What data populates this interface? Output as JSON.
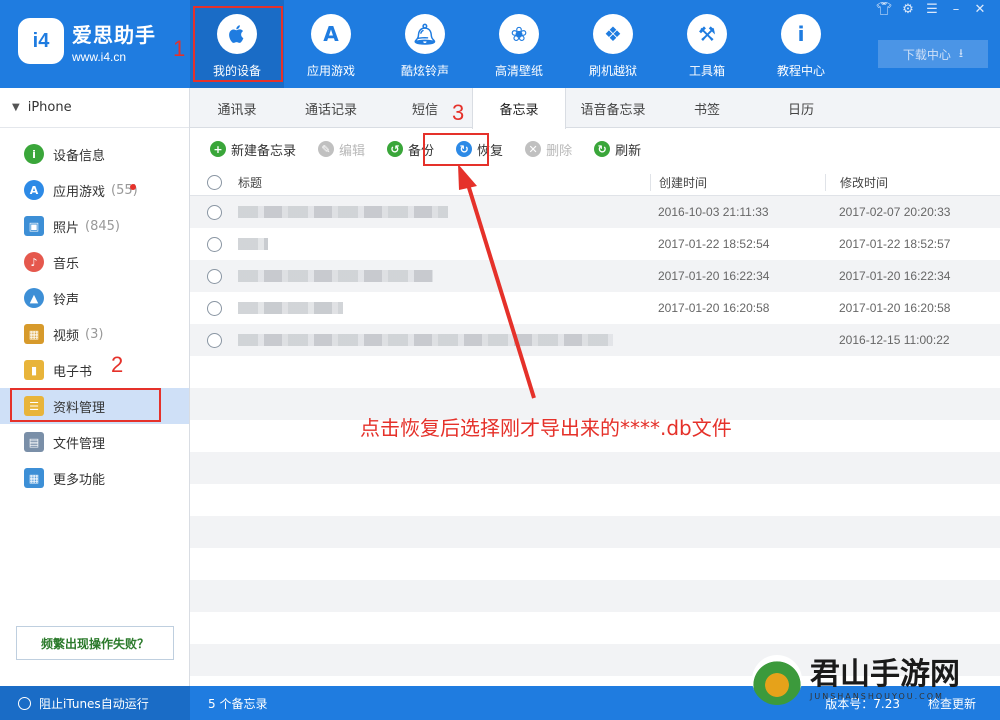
{
  "app": {
    "name": "爱思助手",
    "url": "www.i4.cn",
    "logo_text": "i4"
  },
  "window_controls": [
    "shirt-icon",
    "gear-icon",
    "menu-icon",
    "minimize-icon",
    "close-icon"
  ],
  "nav": [
    {
      "label": "我的设备",
      "icon": "apple-icon",
      "active": true
    },
    {
      "label": "应用游戏",
      "icon": "appstore-icon",
      "active": false
    },
    {
      "label": "酷炫铃声",
      "icon": "bell-icon",
      "active": false
    },
    {
      "label": "高清壁纸",
      "icon": "flower-icon",
      "active": false
    },
    {
      "label": "刷机越狱",
      "icon": "dropbox-icon",
      "active": false
    },
    {
      "label": "工具箱",
      "icon": "tools-icon",
      "active": false
    },
    {
      "label": "教程中心",
      "icon": "info-icon",
      "active": false
    }
  ],
  "download_center": "下载中心",
  "device_name": "iPhone",
  "sidebar": [
    {
      "label": "设备信息",
      "icon": "info-circle-icon",
      "color": "#3aa63a",
      "count": ""
    },
    {
      "label": "应用游戏",
      "icon": "appstore-icon",
      "color": "#2d8ae6",
      "count": "(55)"
    },
    {
      "label": "照片",
      "icon": "photo-icon",
      "color": "#3d8fd6",
      "count": "(845)"
    },
    {
      "label": "音乐",
      "icon": "music-icon",
      "color": "#e5584d",
      "count": ""
    },
    {
      "label": "铃声",
      "icon": "bell-icon",
      "color": "#3d8fd6",
      "count": ""
    },
    {
      "label": "视频",
      "icon": "film-icon",
      "color": "#d79a2b",
      "count": "(3)"
    },
    {
      "label": "电子书",
      "icon": "book-icon",
      "color": "#e8b43a",
      "count": ""
    },
    {
      "label": "资料管理",
      "icon": "contacts-icon",
      "color": "#e8b43a",
      "count": "",
      "active": true
    },
    {
      "label": "文件管理",
      "icon": "file-icon",
      "color": "#7a8fa8",
      "count": ""
    },
    {
      "label": "更多功能",
      "icon": "grid-icon",
      "color": "#3d8fd6",
      "count": ""
    }
  ],
  "fail_button": "频繁出现操作失败？",
  "tabs": [
    "通讯录",
    "通话记录",
    "短信",
    "备忘录",
    "语音备忘录",
    "书签",
    "日历"
  ],
  "active_tab_index": 3,
  "toolbar": [
    {
      "label": "新建备忘录",
      "icon": "plus-circle-icon",
      "color": "#3aa63a",
      "disabled": false
    },
    {
      "label": "编辑",
      "icon": "edit-icon",
      "color": "#c0c0c0",
      "disabled": true
    },
    {
      "label": "备份",
      "icon": "backup-icon",
      "color": "#3aa63a",
      "disabled": false
    },
    {
      "label": "恢复",
      "icon": "restore-icon",
      "color": "#2d8ae6",
      "disabled": false
    },
    {
      "label": "删除",
      "icon": "delete-icon",
      "color": "#c0c0c0",
      "disabled": true
    },
    {
      "label": "刷新",
      "icon": "refresh-icon",
      "color": "#3aa63a",
      "disabled": false
    }
  ],
  "table": {
    "headers": [
      "标题",
      "创建时间",
      "修改时间"
    ],
    "rows": [
      {
        "created": "2016-10-03 21:11:33",
        "modified": "2017-02-07 20:20:33"
      },
      {
        "created": "2017-01-22 18:52:54",
        "modified": "2017-01-22 18:52:57"
      },
      {
        "created": "2017-01-20 16:22:34",
        "modified": "2017-01-20 16:22:34"
      },
      {
        "created": "2017-01-20 16:20:58",
        "modified": "2017-01-20 16:20:58"
      },
      {
        "created": "",
        "modified": "2016-12-15 11:00:22"
      }
    ]
  },
  "status": {
    "itunes_label": "阻止iTunes自动运行",
    "count_label": "5 个备忘录",
    "version_label": "版本号：7.23",
    "update_label": "检查更新"
  },
  "annotations": {
    "num1": "1",
    "num2": "2",
    "num3": "3",
    "instruction": "点击恢复后选择刚才导出来的****.db文件",
    "color": "#e5312a"
  },
  "watermark": {
    "title": "君山手游网",
    "subtitle": "JUNSHANSHOUYOU.COM"
  }
}
